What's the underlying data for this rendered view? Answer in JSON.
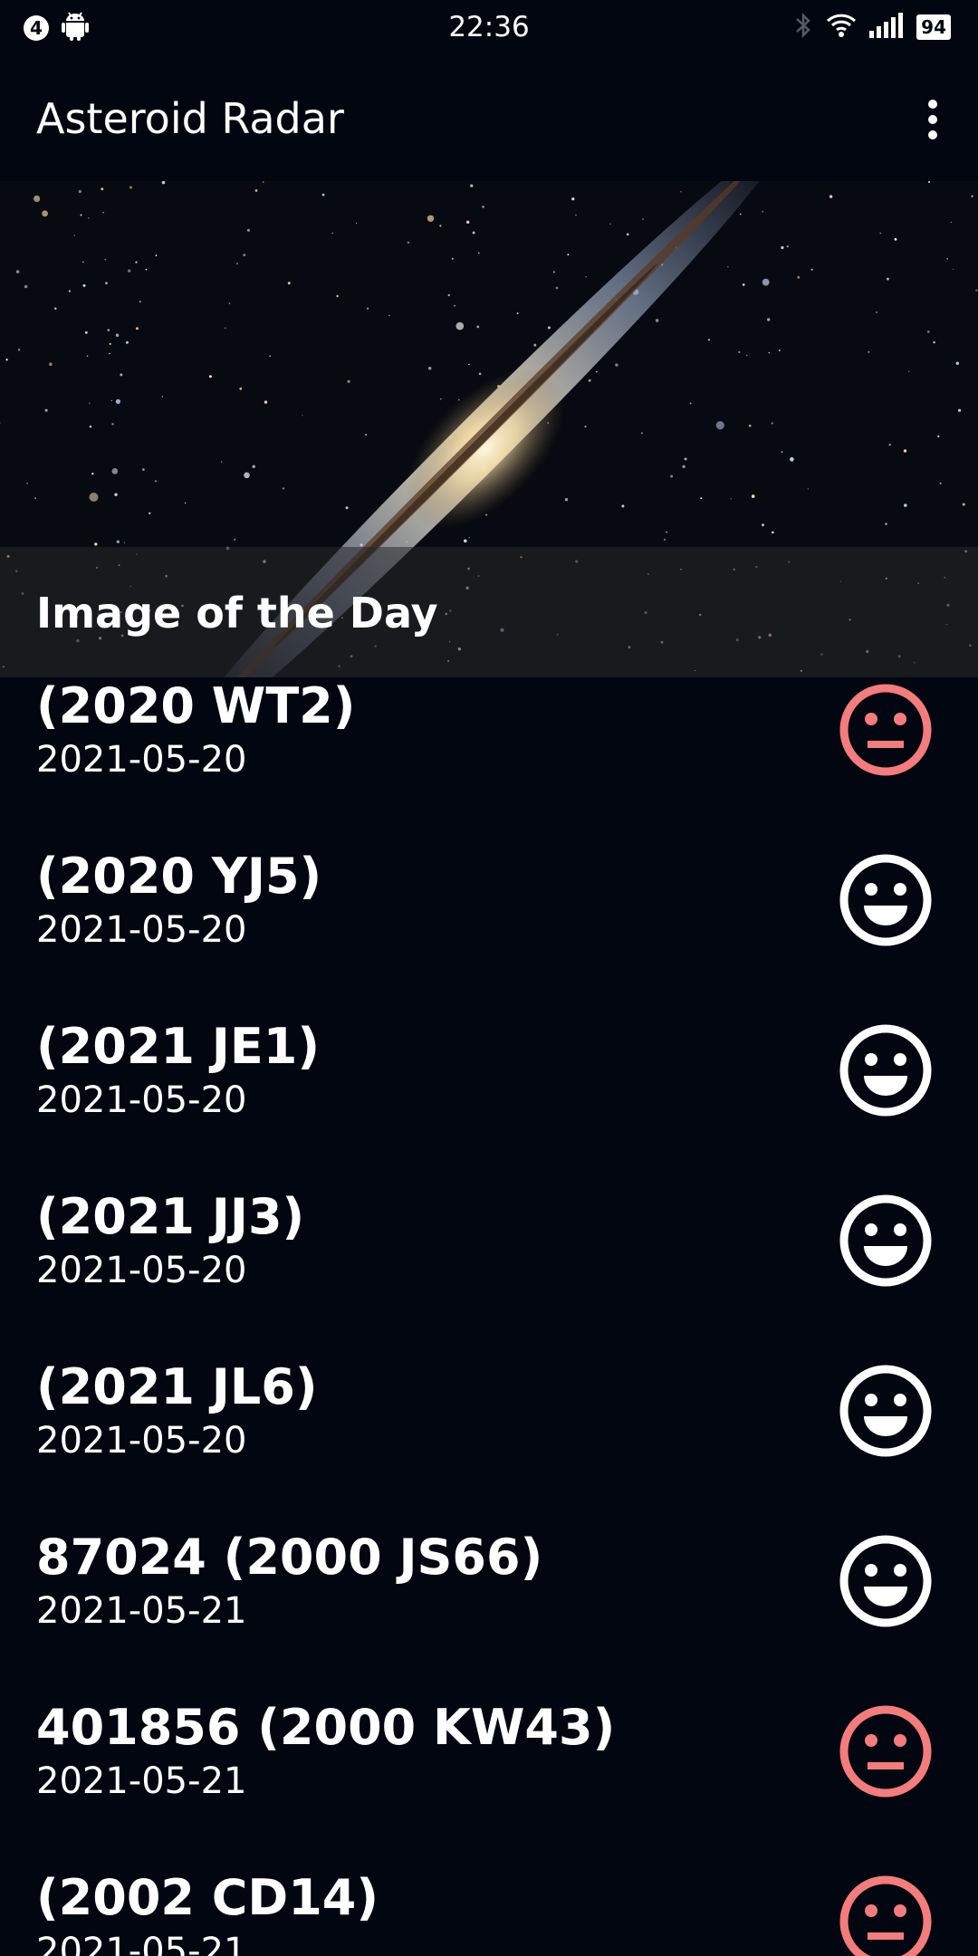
{
  "status_bar": {
    "notification_count": "4",
    "time": "22:36",
    "battery": "94"
  },
  "app_bar": {
    "title": "Asteroid Radar",
    "menu_icon": "overflow-menu-icon"
  },
  "hero": {
    "caption": "Image of the Day"
  },
  "colors": {
    "background": "#020611",
    "hazardous": "#f47c7c",
    "safe": "#ffffff"
  },
  "asteroids": [
    {
      "name": "(2020 WT2)",
      "date": "2021-05-20",
      "hazardous": true
    },
    {
      "name": "(2020 YJ5)",
      "date": "2021-05-20",
      "hazardous": false
    },
    {
      "name": "(2021 JE1)",
      "date": "2021-05-20",
      "hazardous": false
    },
    {
      "name": "(2021 JJ3)",
      "date": "2021-05-20",
      "hazardous": false
    },
    {
      "name": "(2021 JL6)",
      "date": "2021-05-20",
      "hazardous": false
    },
    {
      "name": "87024 (2000 JS66)",
      "date": "2021-05-21",
      "hazardous": false
    },
    {
      "name": "401856 (2000 KW43)",
      "date": "2021-05-21",
      "hazardous": true
    },
    {
      "name": "(2002 CD14)",
      "date": "2021-05-21",
      "hazardous": true
    }
  ]
}
